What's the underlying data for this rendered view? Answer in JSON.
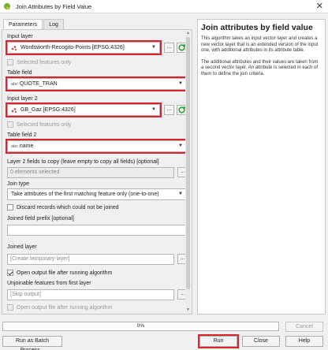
{
  "window": {
    "title": "Join Attributes by Field Value",
    "close_glyph": "✕"
  },
  "tabs": [
    {
      "label": "Parameters"
    },
    {
      "label": "Log"
    }
  ],
  "params": {
    "input_layer": {
      "label": "Input layer",
      "value": "Wordsworth-Recogito-Points [EPSG:4326]"
    },
    "input_selected_only": "Selected features only",
    "table_field": {
      "label": "Table field",
      "type": "abc",
      "value": "QUOTE_TRAN"
    },
    "input_layer_2": {
      "label": "Input layer 2",
      "value": "GB_Gaz [EPSG:4326]"
    },
    "input2_selected_only": "Selected features only",
    "table_field_2": {
      "label": "Table field 2",
      "type": "abc",
      "value": "name"
    },
    "fields_to_copy": {
      "label": "Layer 2 fields to copy (leave empty to copy all fields) [optional]",
      "value": "0 elements selected"
    },
    "join_type": {
      "label": "Join type",
      "value": "Take attributes of the first matching feature only (one-to-one)"
    },
    "discard": "Discard records which could not be joined",
    "prefix": {
      "label": "Joined field prefix [optional]",
      "value": ""
    },
    "joined_layer": {
      "label": "Joined layer",
      "placeholder": "[Create temporary layer]"
    },
    "open_output": "Open output file after running algorithm",
    "unjoinable": {
      "label": "Unjoinable features from first layer",
      "placeholder": "[Skip output]"
    },
    "open_output_2": "Open output file after running algorithm",
    "dots": "..."
  },
  "help": {
    "title": "Join attributes by field value",
    "p1": "This algorithm takes an input vector layer and creates a new vector layer that is an extended version of the input one, with additional attributes in its attribute table.",
    "p2": "The additional attributes and their values are taken from a second vector layer. An attribute is selected in each of them to define the join criteria."
  },
  "footer": {
    "progress": "0%",
    "progress_value": 0,
    "cancel": "Cancel",
    "batch": "Run as Batch Process...",
    "run": "Run",
    "close": "Close",
    "help": "Help"
  },
  "colors": {
    "highlight": "#d9232d",
    "accent": "#2f9e3a"
  }
}
